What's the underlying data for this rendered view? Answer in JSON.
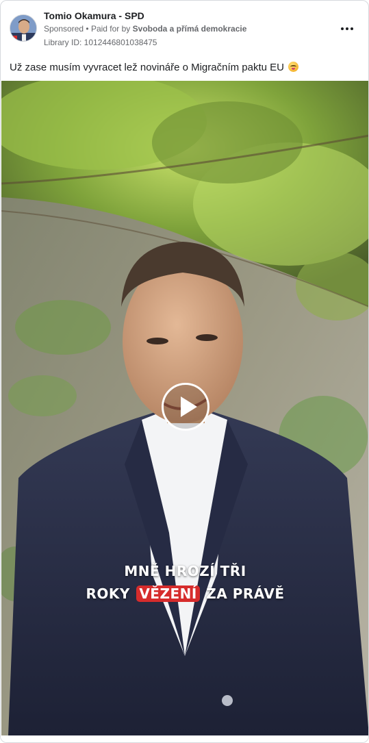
{
  "post": {
    "page_name": "Tomio Okamura - SPD",
    "sponsored_label": "Sponsored",
    "separator": "•",
    "paid_for_prefix": "Paid for by",
    "payer": "Svoboda a přímá demokracie",
    "library_id": "Library ID: 1012446801038475",
    "caption": "Už zase musím vyvracet lež novináře o Migračním paktu EU",
    "caption_emoji": "face-with-rolling-eyes-emoji",
    "more_icon": "more-horizontal-icon"
  },
  "video": {
    "play_icon": "play-icon",
    "subtitle_line1": "MNĚ HROZÍ TŘI",
    "subtitle_line2_before": "ROKY",
    "subtitle_line2_highlight": "VĚZENÍ",
    "subtitle_line2_after": "ZA PRÁVĚ",
    "highlight_color": "#d62c2c"
  }
}
